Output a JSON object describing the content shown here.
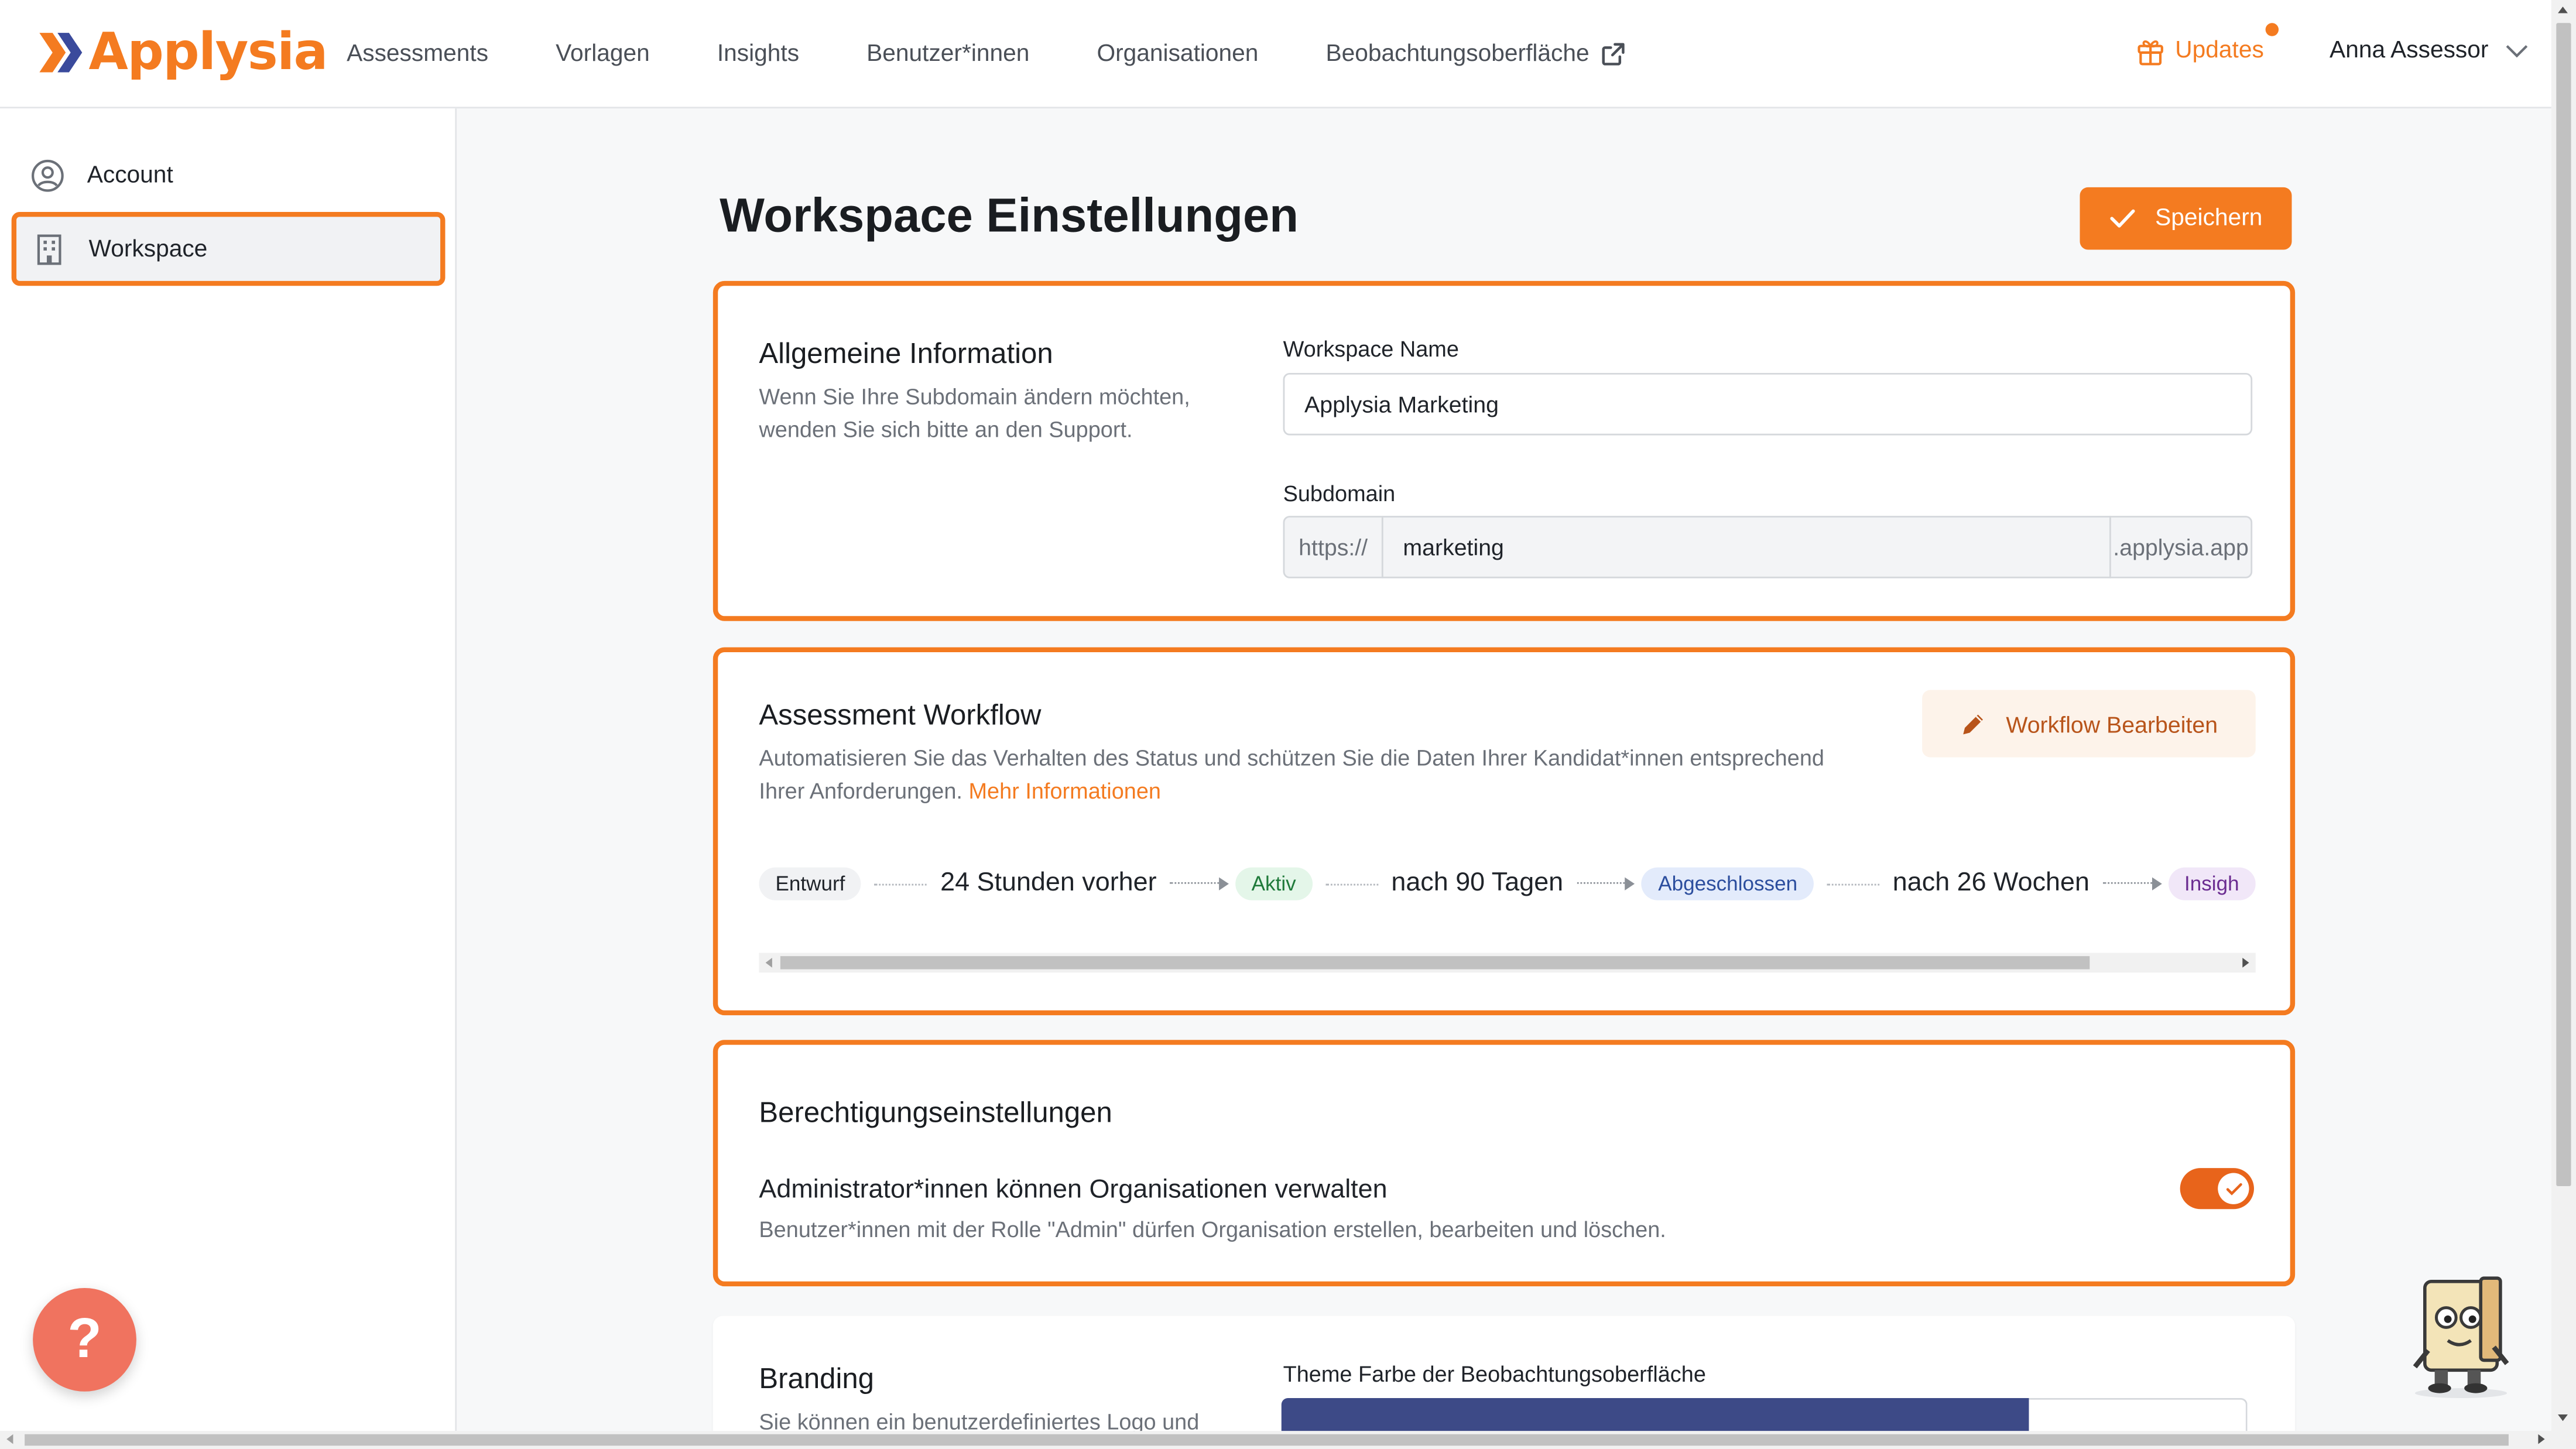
{
  "app": {
    "brand": "Applysia"
  },
  "nav": {
    "items": [
      "Assessments",
      "Vorlagen",
      "Insights",
      "Benutzer*innen",
      "Organisationen",
      "Beobachtungsoberfläche"
    ],
    "updates_label": "Updates",
    "user_name": "Anna Assessor"
  },
  "sidebar": {
    "items": [
      {
        "label": "Account",
        "icon": "user-circle-icon",
        "active": false
      },
      {
        "label": "Workspace",
        "icon": "building-icon",
        "active": true
      }
    ]
  },
  "page": {
    "title": "Workspace Einstellungen",
    "save_label": "Speichern"
  },
  "general": {
    "title": "Allgemeine Information",
    "desc_line1": "Wenn Sie Ihre Subdomain ändern möchten,",
    "desc_line2": "wenden Sie sich bitte an den Support.",
    "name_label": "Workspace Name",
    "name_value": "Applysia Marketing",
    "subdomain_label": "Subdomain",
    "subdomain_prefix": "https://",
    "subdomain_value": "marketing",
    "subdomain_suffix": ".applysia.app"
  },
  "workflow": {
    "title": "Assessment Workflow",
    "desc_line1": "Automatisieren Sie das Verhalten des Status und schützen Sie die Daten Ihrer Kandidat*innen entsprechend",
    "desc_line2": "Ihrer Anforderungen.",
    "more_link": "Mehr Informationen",
    "edit_label": "Workflow Bearbeiten",
    "steps": {
      "s1": "Entwurf",
      "t1": "24 Stunden vorher",
      "s2": "Aktiv",
      "t2": "nach 90 Tagen",
      "s3": "Abgeschlossen",
      "t3": "nach 26 Wochen",
      "s4": "Insigh"
    }
  },
  "permissions": {
    "title": "Berechtigungseinstellungen",
    "setting_title": "Administrator*innen können Organisationen verwalten",
    "setting_desc": "Benutzer*innen mit der Rolle \"Admin\" dürfen Organisation erstellen, bearbeiten und löschen.",
    "enabled": true
  },
  "branding": {
    "title": "Branding",
    "desc_partial": "Sie können ein benutzerdefiniertes Logo und",
    "theme_label": "Theme Farbe der Beobachtungsoberfläche",
    "theme_color": "#3d4a87"
  },
  "help": {
    "label": "?"
  },
  "colors": {
    "accent": "#f47b20",
    "brand_blue": "#3a4a9c"
  }
}
